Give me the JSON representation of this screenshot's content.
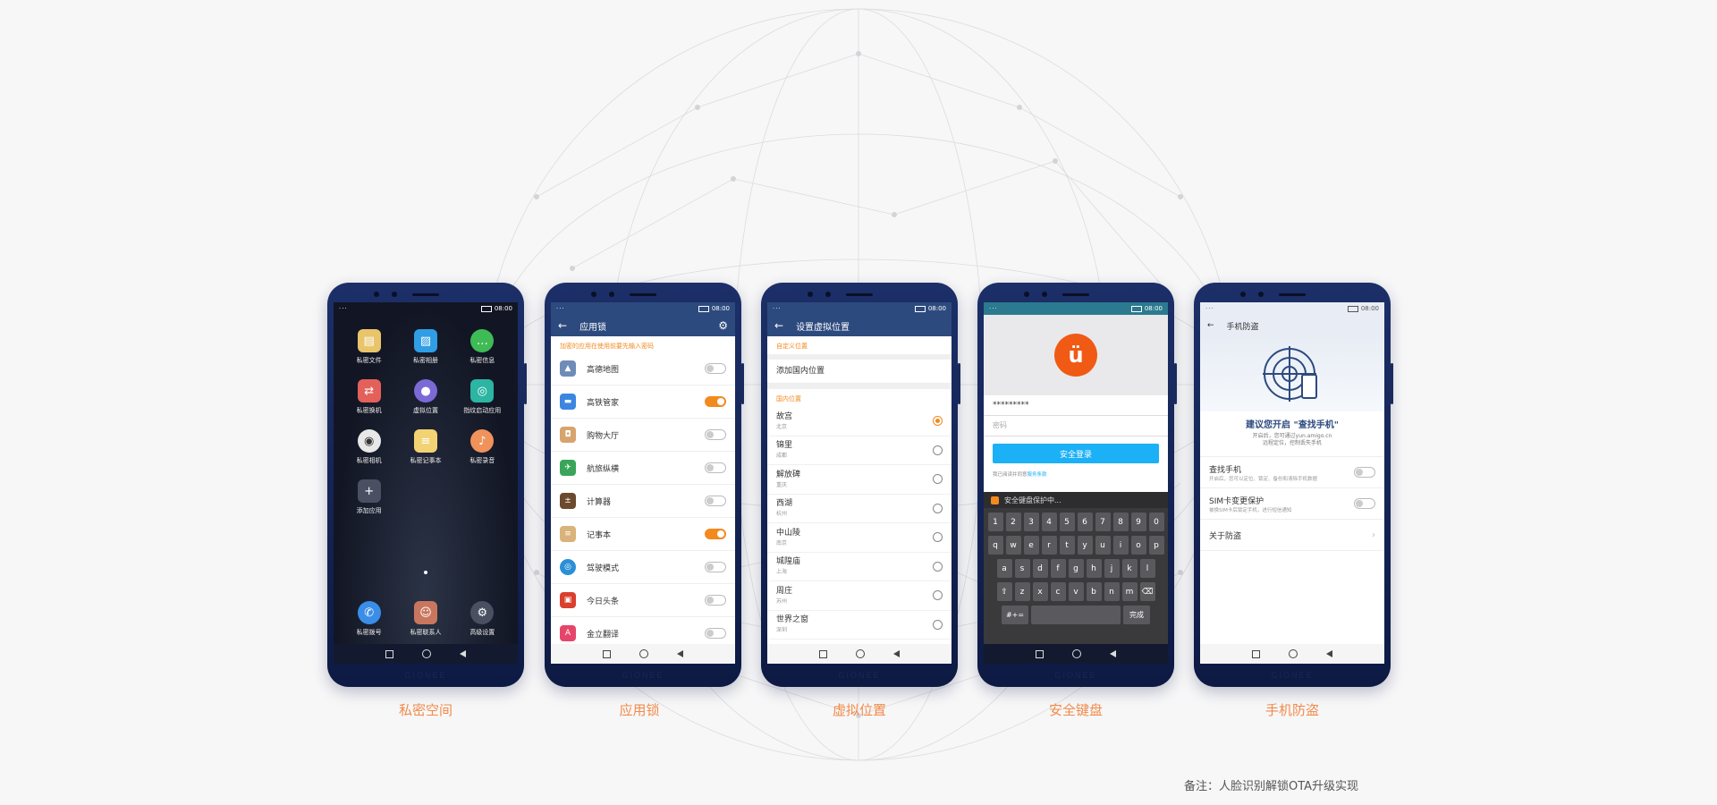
{
  "phones": [
    {
      "caption": "私密空间",
      "status_time": "08:00",
      "apps": [
        "私密文件",
        "私密相册",
        "私密信息",
        "私密换机",
        "虚拟位置",
        "指纹启动应用",
        "私密相机",
        "私密记事本",
        "私密录音",
        "添加应用"
      ],
      "dock": [
        "私密拨号",
        "私密联系人",
        "高级设置"
      ]
    },
    {
      "caption": "应用锁",
      "status_time": "08:00",
      "title": "应用锁",
      "tip": "加密的应用在使用前要先输入密码",
      "items": [
        {
          "name": "高德地图",
          "on": false
        },
        {
          "name": "高铁管家",
          "on": true
        },
        {
          "name": "购物大厅",
          "on": false
        },
        {
          "name": "航旅纵横",
          "on": false
        },
        {
          "name": "计算器",
          "on": false
        },
        {
          "name": "记事本",
          "on": true
        },
        {
          "name": "驾驶模式",
          "on": false
        },
        {
          "name": "今日头条",
          "on": false
        },
        {
          "name": "金立翻译",
          "on": false
        }
      ]
    },
    {
      "caption": "虚拟位置",
      "status_time": "08:00",
      "title": "设置虚拟位置",
      "custom_section": "自定义位置",
      "add_location": "添加国内位置",
      "domestic_section": "国内位置",
      "locations": [
        {
          "name": "故宫",
          "city": "北京",
          "selected": true
        },
        {
          "name": "锦里",
          "city": "成都",
          "selected": false
        },
        {
          "name": "解放碑",
          "city": "重庆",
          "selected": false
        },
        {
          "name": "西湖",
          "city": "杭州",
          "selected": false
        },
        {
          "name": "中山陵",
          "city": "南京",
          "selected": false
        },
        {
          "name": "城隍庙",
          "city": "上海",
          "selected": false
        },
        {
          "name": "周庄",
          "city": "苏州",
          "selected": false
        },
        {
          "name": "世界之窗",
          "city": "深圳",
          "selected": false
        }
      ]
    },
    {
      "caption": "安全键盘",
      "status_time": "08:00",
      "password_value": "*********",
      "password_placeholder": "密码",
      "login_label": "安全登录",
      "agreement_text": "我已阅读并同意",
      "agreement_link": "服务条款",
      "keyboard_banner": "安全键盘保护中...",
      "keys_row1": [
        "1",
        "2",
        "3",
        "4",
        "5",
        "6",
        "7",
        "8",
        "9",
        "0"
      ],
      "keys_row2": [
        "q",
        "w",
        "e",
        "r",
        "t",
        "y",
        "u",
        "i",
        "o",
        "p"
      ],
      "keys_row3": [
        "a",
        "s",
        "d",
        "f",
        "g",
        "h",
        "j",
        "k",
        "l"
      ],
      "keys_row4": [
        "z",
        "x",
        "c",
        "v",
        "b",
        "n",
        "m"
      ],
      "symbol_key": "#+=",
      "done_key": "完成"
    },
    {
      "caption": "手机防盗",
      "status_time": "08:00",
      "title": "手机防盗",
      "suggest": "建议您开启 \"查找手机\"",
      "suggest_desc1": "开启后，您可通过yun.amigo.cn",
      "suggest_desc2": "远程定位，控制丢失手机",
      "rows": [
        {
          "title": "查找手机",
          "desc": "开启后，您可以定位、锁定、备份和清除手机数据"
        },
        {
          "title": "SIM卡变更保护",
          "desc": "被换SIM卡后锁定手机，进行短信通知"
        },
        {
          "title": "关于防盗",
          "desc": ""
        }
      ]
    }
  ],
  "brand": "GIONEE",
  "note": "备注：人脸识别解锁OTA升级实现",
  "colors": {
    "accent": "#f28a1e",
    "caption": "#f28a4a",
    "header_blue": "#2d4a7e",
    "login_blue": "#1cb0f6"
  }
}
